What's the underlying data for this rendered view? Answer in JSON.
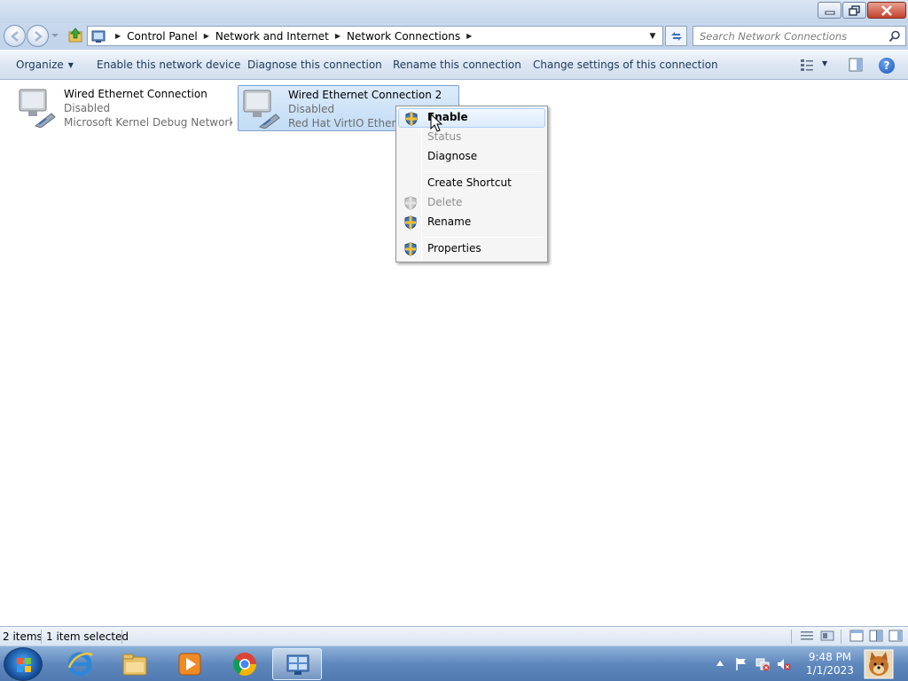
{
  "window": {
    "minimize_label": "Minimize",
    "maximize_label": "Restore",
    "close_label": "Close"
  },
  "address": {
    "crumbs": [
      "Control Panel",
      "Network and Internet",
      "Network Connections"
    ],
    "search_placeholder": "Search Network Connections"
  },
  "toolbar": {
    "organize": "Organize",
    "enable": "Enable this network device",
    "diagnose": "Diagnose this connection",
    "rename": "Rename this connection",
    "change": "Change settings of this connection",
    "help": "?"
  },
  "connections": [
    {
      "name": "Wired Ethernet Connection",
      "status": "Disabled",
      "device": "Microsoft Kernel Debug Network ..."
    },
    {
      "name": "Wired Ethernet Connection 2",
      "status": "Disabled",
      "device": "Red Hat VirtIO Ethernet"
    }
  ],
  "context_menu": {
    "items": [
      {
        "label": "Enable",
        "icon": "shield-icon",
        "state": "highlighted"
      },
      {
        "label": "Status",
        "icon": "",
        "state": "disabled"
      },
      {
        "label": "Diagnose",
        "icon": "",
        "state": "normal"
      },
      {
        "label": "Create Shortcut",
        "icon": "",
        "state": "normal"
      },
      {
        "label": "Delete",
        "icon": "shield-icon",
        "state": "disabled"
      },
      {
        "label": "Rename",
        "icon": "shield-icon",
        "state": "normal"
      },
      {
        "label": "Properties",
        "icon": "shield-icon",
        "state": "normal"
      }
    ]
  },
  "statusbar": {
    "items_count": "2 items",
    "selected": "1 item selected"
  },
  "taskbar": {
    "apps": [
      "internet-explorer-icon",
      "file-explorer-icon",
      "media-player-icon",
      "chrome-icon",
      "network-connections-icon"
    ],
    "time": "9:48 PM",
    "date": "1/1/2023"
  },
  "colors": {
    "accent": "#1e395b",
    "selection": "#c2dcf5",
    "taskbar": "#5f88bd"
  }
}
